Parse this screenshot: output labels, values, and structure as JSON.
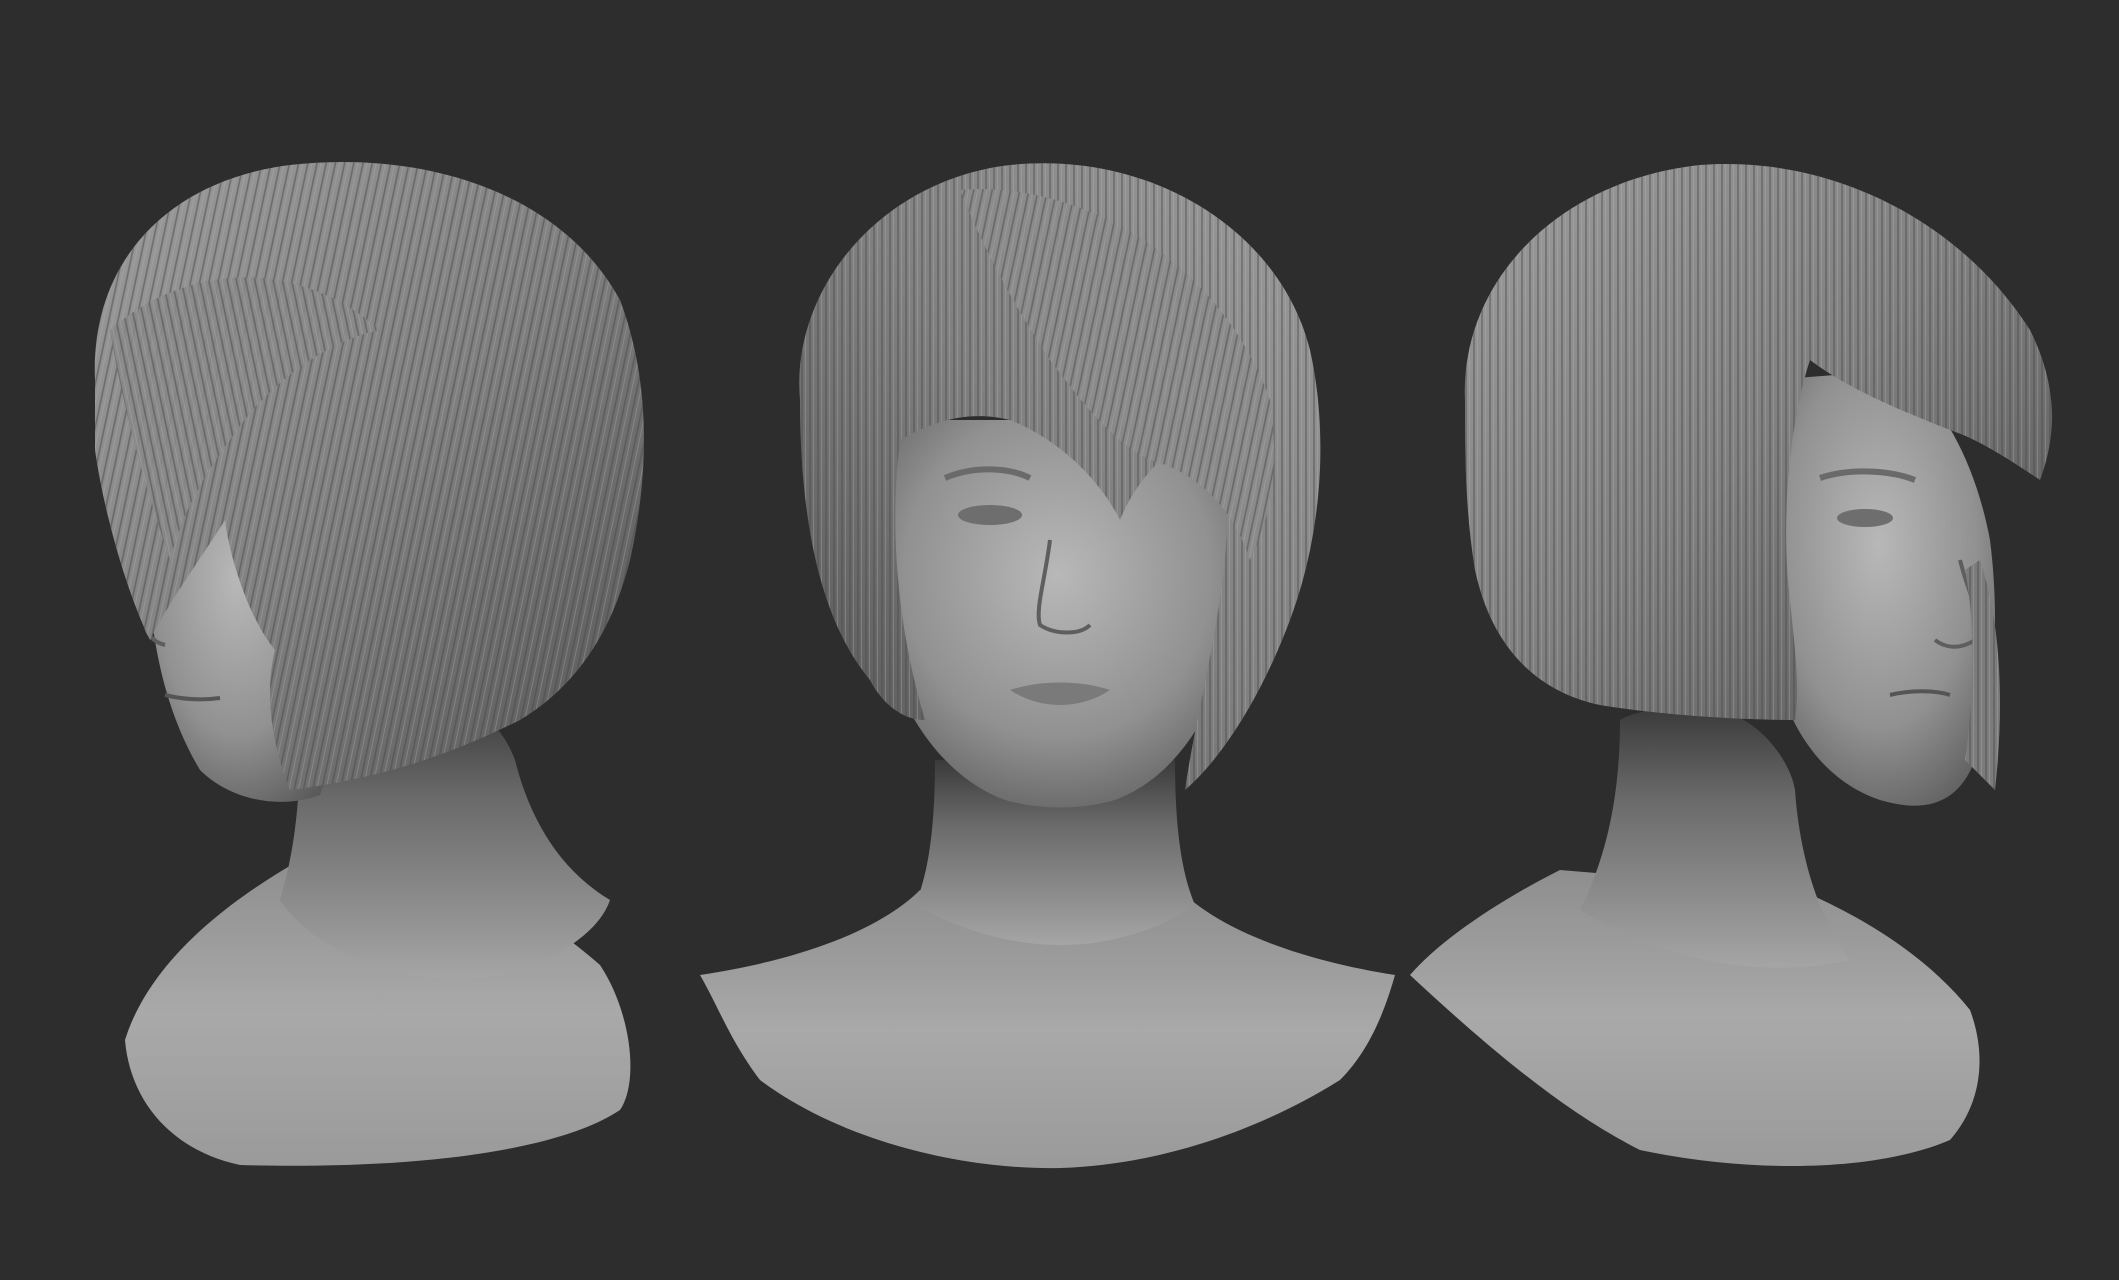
{
  "scene": {
    "background_color": "#2d2d2d",
    "render_style": "clay-sculpt-turnaround",
    "views": [
      {
        "name": "three-quarter-left",
        "facing": "left"
      },
      {
        "name": "front",
        "facing": "front"
      },
      {
        "name": "three-quarter-right",
        "facing": "right"
      }
    ],
    "material": {
      "skin_light": "#a8a8a8",
      "skin_mid": "#858585",
      "skin_dark": "#4a4a4a",
      "hair_light": "#9a9a9a",
      "hair_mid": "#7a7a7a",
      "hair_dark": "#3e3e3e",
      "shadow": "#1c1c1c"
    }
  }
}
